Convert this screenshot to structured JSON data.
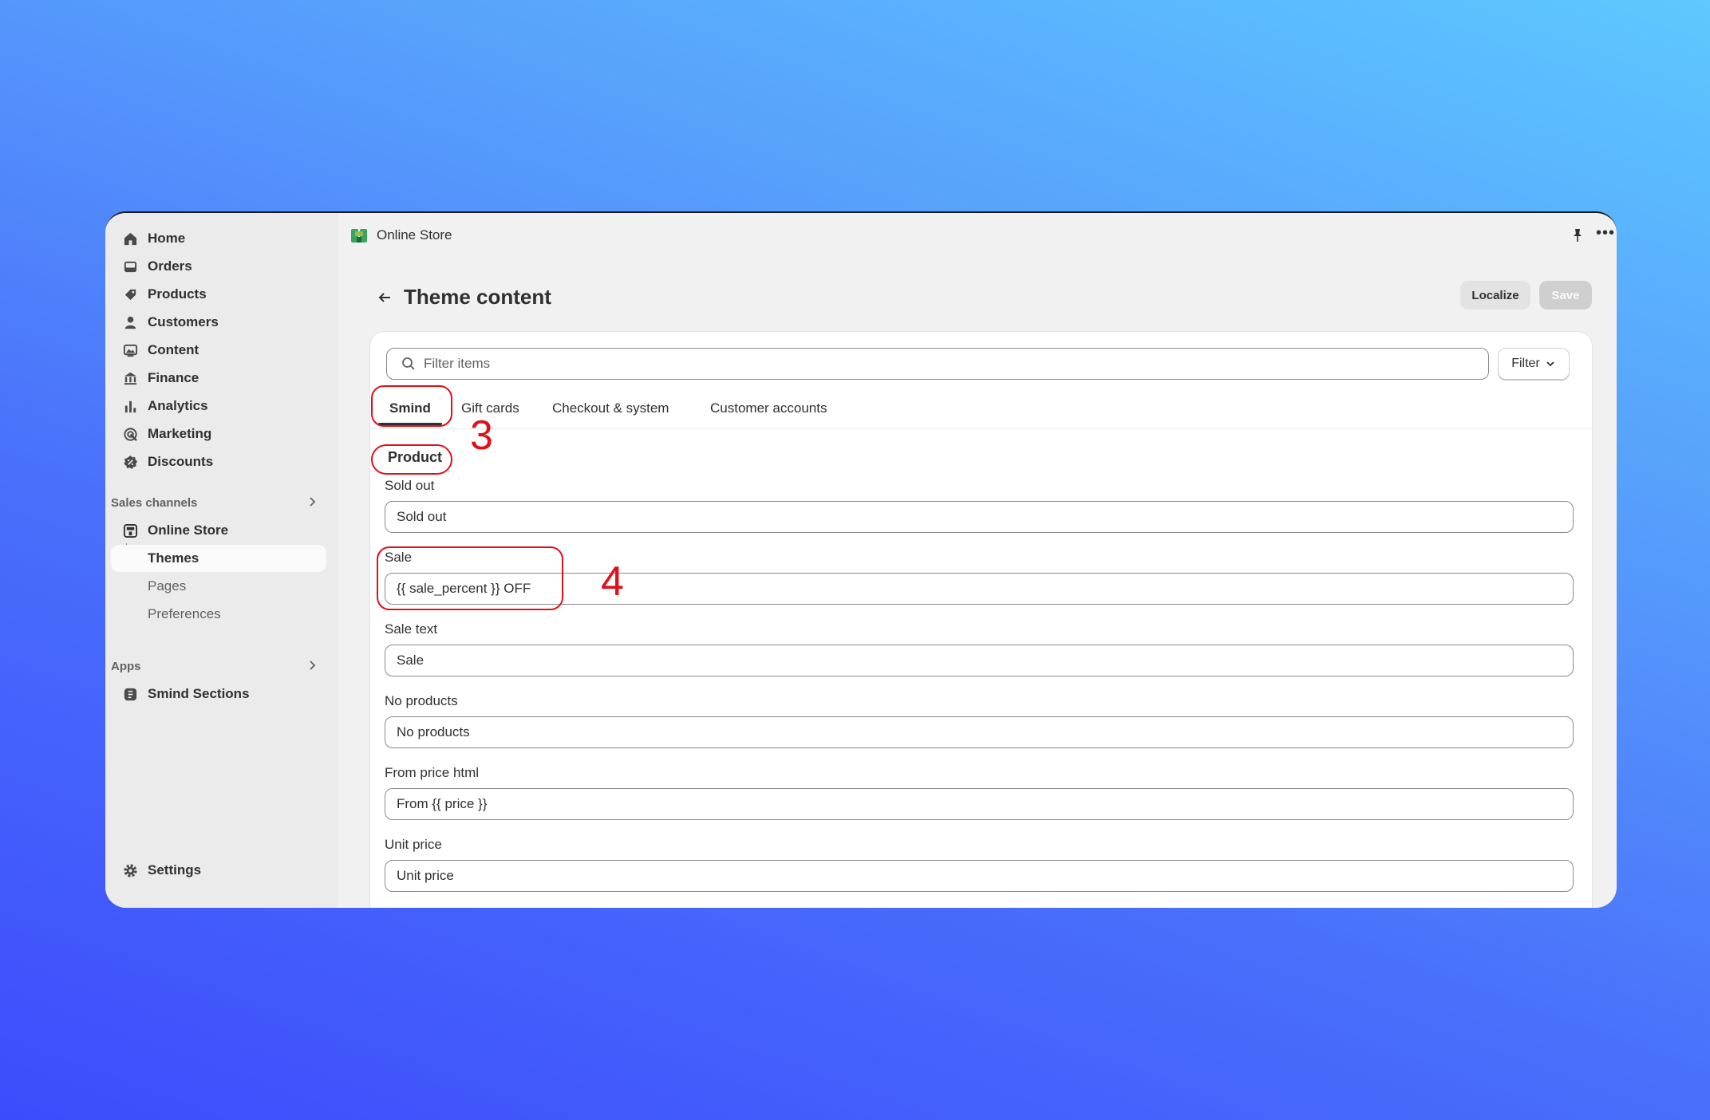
{
  "sidebar": {
    "items": [
      {
        "label": "Home",
        "icon": "home-icon"
      },
      {
        "label": "Orders",
        "icon": "inbox-icon"
      },
      {
        "label": "Products",
        "icon": "tag-icon"
      },
      {
        "label": "Customers",
        "icon": "person-icon"
      },
      {
        "label": "Content",
        "icon": "image-icon"
      },
      {
        "label": "Finance",
        "icon": "bank-icon"
      },
      {
        "label": "Analytics",
        "icon": "bar-chart-icon"
      },
      {
        "label": "Marketing",
        "icon": "target-icon"
      },
      {
        "label": "Discounts",
        "icon": "discount-icon"
      }
    ],
    "sales_channels_label": "Sales channels",
    "channels": {
      "online_store": "Online Store",
      "themes": "Themes",
      "pages": "Pages",
      "preferences": "Preferences"
    },
    "apps_label": "Apps",
    "apps": {
      "smind_sections": "Smind Sections"
    },
    "settings": "Settings"
  },
  "topbar": {
    "title": "Online Store"
  },
  "page": {
    "title": "Theme content",
    "localize": "Localize",
    "save": "Save"
  },
  "search": {
    "placeholder": "Filter items"
  },
  "filter_label": "Filter",
  "tabs": [
    "Smind",
    "Gift cards",
    "Checkout & system",
    "Customer accounts"
  ],
  "group_title": "Product",
  "fields": [
    {
      "label": "Sold out",
      "value": "Sold out"
    },
    {
      "label": "Sale",
      "value": "{{ sale_percent }} OFF"
    },
    {
      "label": "Sale text",
      "value": "Sale"
    },
    {
      "label": "No products",
      "value": "No products"
    },
    {
      "label": "From price html",
      "value": "From {{ price }}"
    },
    {
      "label": "Unit price",
      "value": "Unit price"
    }
  ],
  "annotations": {
    "step_tabs": "3",
    "step_field": "4"
  },
  "colors": {
    "annotation": "#e0101a",
    "accent_text": "#303030"
  }
}
